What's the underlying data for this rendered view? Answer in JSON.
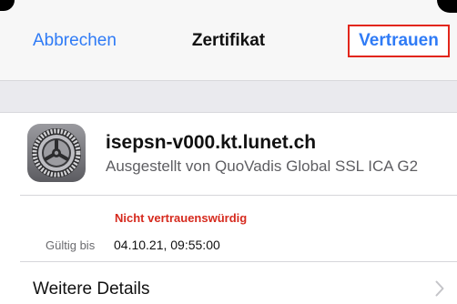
{
  "navbar": {
    "cancel_label": "Abbrechen",
    "title": "Zertifikat",
    "trust_label": "Vertrauen"
  },
  "certificate": {
    "name": "isepsn-v000.kt.lunet.ch",
    "issuer": "Ausgestellt von QuoVadis Global SSL ICA G2",
    "icon": "settings-gear-icon"
  },
  "status": {
    "trust_status": "Nicht vertrauenswürdig",
    "valid_until_label": "Gültig bis",
    "valid_until_value": "04.10.21, 09:55:00"
  },
  "details": {
    "label": "Weitere Details",
    "icon": "chevron-right-icon"
  },
  "colors": {
    "accent": "#2f7bf6",
    "warning": "#d62a1e",
    "highlight_border": "#e2261b"
  }
}
